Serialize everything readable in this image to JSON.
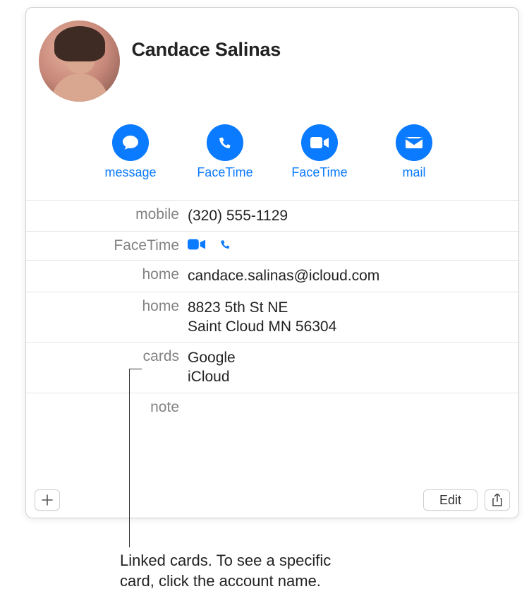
{
  "contact": {
    "name": "Candace Salinas"
  },
  "actions": {
    "message": "message",
    "facetime1": "FaceTime",
    "facetime2": "FaceTime",
    "mail": "mail"
  },
  "fields": {
    "mobile": {
      "label": "mobile",
      "value": "(320) 555-1129"
    },
    "facetime": {
      "label": "FaceTime"
    },
    "email": {
      "label": "home",
      "value": "candace.salinas@icloud.com"
    },
    "address": {
      "label": "home",
      "line1": "8823 5th St NE",
      "line2": "Saint Cloud MN 56304"
    },
    "cards": {
      "label": "cards",
      "value1": "Google",
      "value2": "iCloud"
    },
    "note": {
      "label": "note"
    }
  },
  "footer": {
    "edit": "Edit"
  },
  "callout": {
    "line1": "Linked cards. To see a specific",
    "line2": "card, click the account name."
  }
}
